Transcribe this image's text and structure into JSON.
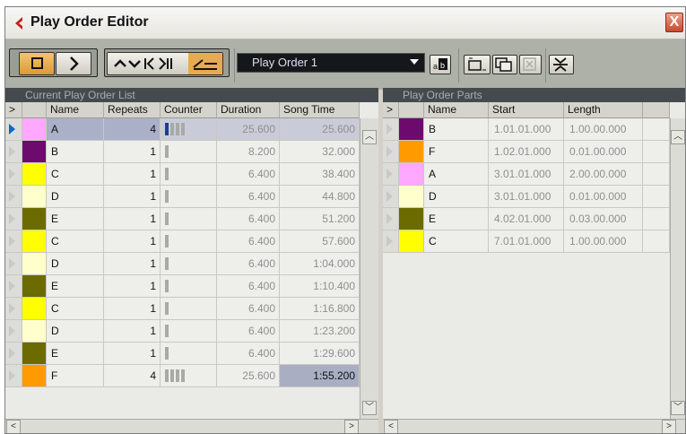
{
  "window": {
    "title": "Play Order Editor",
    "close_label": "X"
  },
  "toolbar": {
    "play_order_name": "Play Order 1",
    "accent_color": "#e8aa50",
    "dropdown_bg": "#15181b"
  },
  "left_panel": {
    "title": "Current Play Order List",
    "columns": [
      ">",
      "",
      "Name",
      "Repeats",
      "Counter",
      "Duration",
      "Song Time"
    ],
    "rows": [
      {
        "color": "#ffa8ff",
        "name": "A",
        "repeats": "4",
        "counter": 4,
        "duration": "25.600",
        "song_time": "25.600",
        "selected": true
      },
      {
        "color": "#6e0a6e",
        "name": "B",
        "repeats": "1",
        "counter": 1,
        "duration": "8.200",
        "song_time": "32.000"
      },
      {
        "color": "#ffff00",
        "name": "C",
        "repeats": "1",
        "counter": 1,
        "duration": "6.400",
        "song_time": "38.400"
      },
      {
        "color": "#ffffcc",
        "name": "D",
        "repeats": "1",
        "counter": 1,
        "duration": "6.400",
        "song_time": "44.800"
      },
      {
        "color": "#6b6b00",
        "name": "E",
        "repeats": "1",
        "counter": 1,
        "duration": "6.400",
        "song_time": "51.200"
      },
      {
        "color": "#ffff00",
        "name": "C",
        "repeats": "1",
        "counter": 1,
        "duration": "6.400",
        "song_time": "57.600"
      },
      {
        "color": "#ffffcc",
        "name": "D",
        "repeats": "1",
        "counter": 1,
        "duration": "6.400",
        "song_time": "1:04.000"
      },
      {
        "color": "#6b6b00",
        "name": "E",
        "repeats": "1",
        "counter": 1,
        "duration": "6.400",
        "song_time": "1:10.400"
      },
      {
        "color": "#ffff00",
        "name": "C",
        "repeats": "1",
        "counter": 1,
        "duration": "6.400",
        "song_time": "1:16.800"
      },
      {
        "color": "#ffffcc",
        "name": "D",
        "repeats": "1",
        "counter": 1,
        "duration": "6.400",
        "song_time": "1:23.200"
      },
      {
        "color": "#6b6b00",
        "name": "E",
        "repeats": "1",
        "counter": 1,
        "duration": "6.400",
        "song_time": "1:29.600"
      },
      {
        "color": "#ff9a00",
        "name": "F",
        "repeats": "4",
        "counter": 4,
        "duration": "25.600",
        "song_time": "1:55.200",
        "highlight_time": true
      }
    ]
  },
  "right_panel": {
    "title": "Play Order Parts",
    "columns": [
      ">",
      "",
      "Name",
      "Start",
      "Length"
    ],
    "rows": [
      {
        "color": "#6e0a6e",
        "name": "B",
        "start": "1.01.01.000",
        "length": "1.00.00.000"
      },
      {
        "color": "#ff9a00",
        "name": "F",
        "start": "1.02.01.000",
        "length": "0.01.00.000"
      },
      {
        "color": "#ffa8ff",
        "name": "A",
        "start": "3.01.01.000",
        "length": "2.00.00.000"
      },
      {
        "color": "#ffffcc",
        "name": "D",
        "start": "3.01.01.000",
        "length": "0.01.00.000"
      },
      {
        "color": "#6b6b00",
        "name": "E",
        "start": "4.02.01.000",
        "length": "0.03.00.000"
      },
      {
        "color": "#ffff00",
        "name": "C",
        "start": "7.01.01.000",
        "length": "1.00.00.000"
      }
    ]
  }
}
